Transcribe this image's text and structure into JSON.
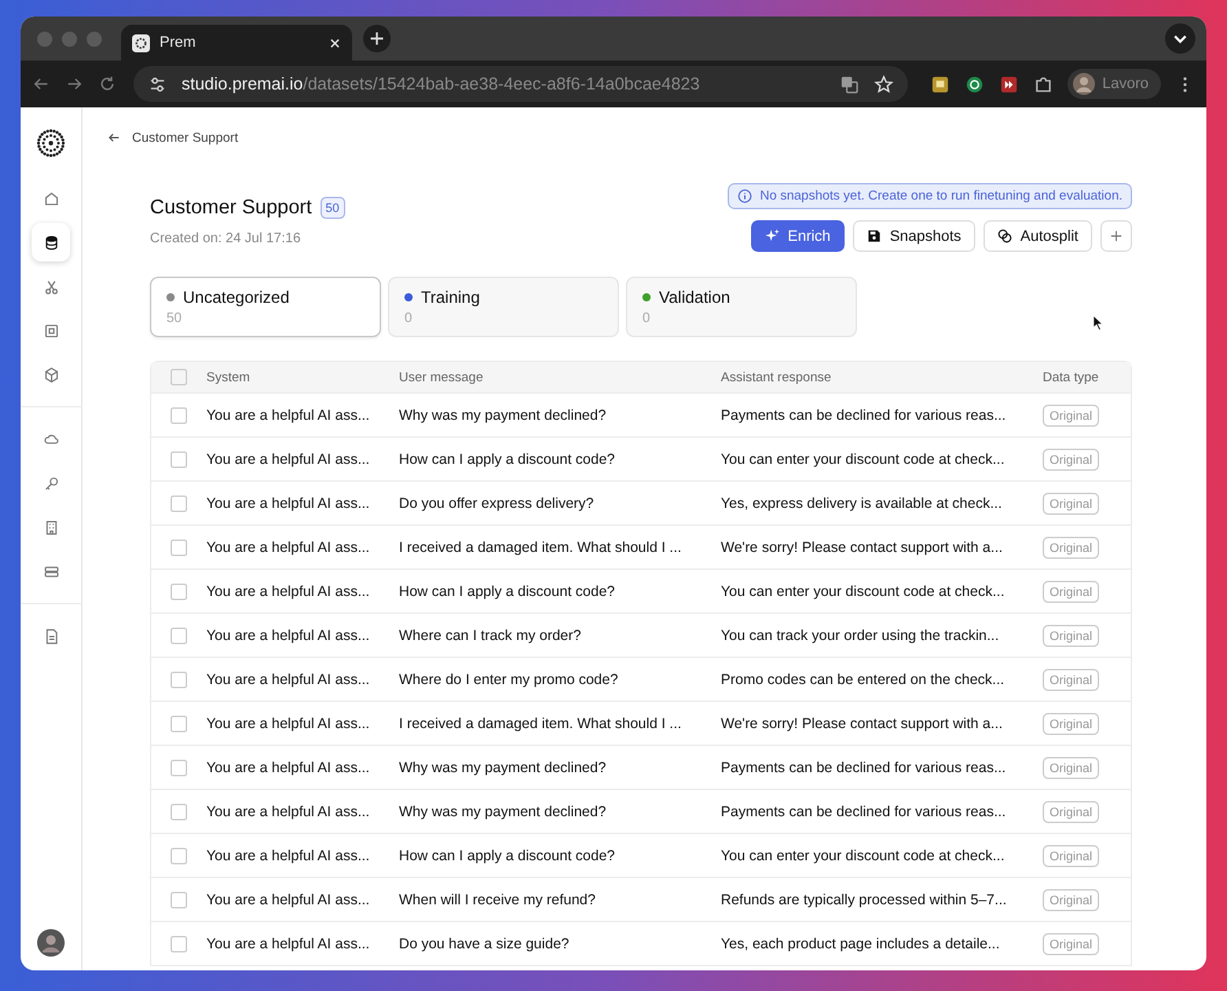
{
  "browser": {
    "tab_title": "Prem",
    "url_host": "studio.premai.io",
    "url_path": "/datasets/15424bab-ae38-4eec-a8f6-14a0bcae4823",
    "profile": "Lavoro"
  },
  "sidebar": {
    "items": [
      {
        "selected": false
      },
      {
        "selected": true
      },
      {
        "selected": false
      },
      {
        "selected": false
      },
      {
        "selected": false
      },
      {
        "selected": false
      },
      {
        "selected": false
      },
      {
        "selected": false
      },
      {
        "selected": false
      },
      {
        "selected": false
      }
    ]
  },
  "breadcrumb": "Customer Support",
  "dataset": {
    "title": "Customer Support",
    "count": "50",
    "created": "Created on: 24 Jul 17:16"
  },
  "notice": "No snapshots yet. Create one to run finetuning and evaluation.",
  "buttons": [
    {
      "label": "Enrich",
      "kind": "primary"
    },
    {
      "label": "Snapshots",
      "kind": "secondary"
    },
    {
      "label": "Autosplit",
      "kind": "secondary"
    },
    {
      "kind": "icon"
    }
  ],
  "categories": [
    {
      "label": "Uncategorized",
      "count": "50",
      "color": "#8a8a8a",
      "selected": true
    },
    {
      "label": "Training",
      "count": "0",
      "color": "#3b5bdb",
      "selected": false
    },
    {
      "label": "Validation",
      "count": "0",
      "color": "#40a02b",
      "selected": false
    }
  ],
  "table": {
    "select_all": {
      "checked": false
    },
    "columns": [
      "System",
      "User message",
      "Assistant response",
      "Data type"
    ],
    "rows": [
      {
        "checked": false,
        "cells": [
          "You are a helpful AI ass...",
          "Why was my payment declined?",
          "Payments can be declined for various reas...",
          "Original"
        ]
      },
      {
        "checked": false,
        "cells": [
          "You are a helpful AI ass...",
          "How can I apply a discount code?",
          "You can enter your discount code at check...",
          "Original"
        ]
      },
      {
        "checked": false,
        "cells": [
          "You are a helpful AI ass...",
          "Do you offer express delivery?",
          "Yes, express delivery is available at check...",
          "Original"
        ]
      },
      {
        "checked": false,
        "cells": [
          "You are a helpful AI ass...",
          "I received a damaged item. What should I ...",
          "We're sorry! Please contact support with a...",
          "Original"
        ]
      },
      {
        "checked": false,
        "cells": [
          "You are a helpful AI ass...",
          "How can I apply a discount code?",
          "You can enter your discount code at check...",
          "Original"
        ]
      },
      {
        "checked": false,
        "cells": [
          "You are a helpful AI ass...",
          "Where can I track my order?",
          "You can track your order using the trackin...",
          "Original"
        ]
      },
      {
        "checked": false,
        "cells": [
          "You are a helpful AI ass...",
          "Where do I enter my promo code?",
          "Promo codes can be entered on the check...",
          "Original"
        ]
      },
      {
        "checked": false,
        "cells": [
          "You are a helpful AI ass...",
          "I received a damaged item. What should I ...",
          "We're sorry! Please contact support with a...",
          "Original"
        ]
      },
      {
        "checked": false,
        "cells": [
          "You are a helpful AI ass...",
          "Why was my payment declined?",
          "Payments can be declined for various reas...",
          "Original"
        ]
      },
      {
        "checked": false,
        "cells": [
          "You are a helpful AI ass...",
          "Why was my payment declined?",
          "Payments can be declined for various reas...",
          "Original"
        ]
      },
      {
        "checked": false,
        "cells": [
          "You are a helpful AI ass...",
          "How can I apply a discount code?",
          "You can enter your discount code at check...",
          "Original"
        ]
      },
      {
        "checked": false,
        "cells": [
          "You are a helpful AI ass...",
          "When will I receive my refund?",
          "Refunds are typically processed within 5–7...",
          "Original"
        ]
      },
      {
        "checked": false,
        "cells": [
          "You are a helpful AI ass...",
          "Do you have a size guide?",
          "Yes, each product page includes a detaile...",
          "Original"
        ]
      }
    ]
  }
}
